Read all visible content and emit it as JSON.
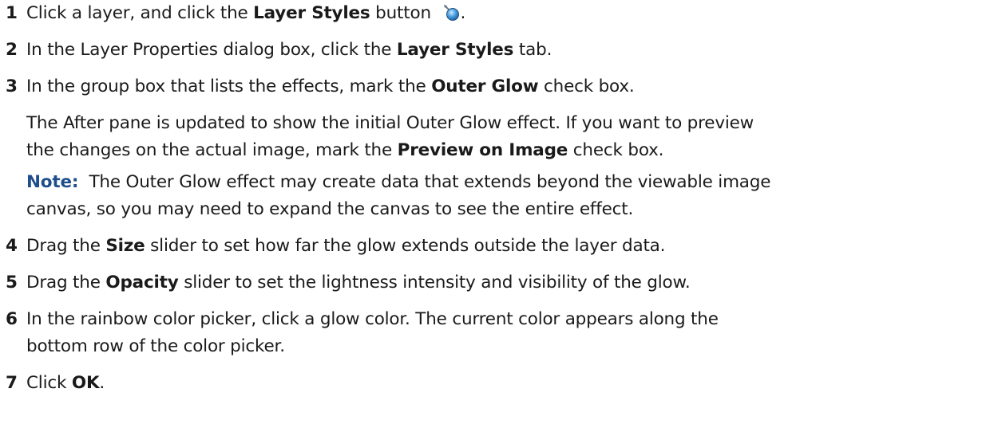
{
  "steps": [
    {
      "num": "1",
      "pre": "Click a layer, and click the ",
      "bold": "Layer Styles",
      "post": " button ",
      "after_icon": ".",
      "icon": "layer-styles-icon"
    },
    {
      "num": "2",
      "pre": "In the Layer Properties dialog box, click the ",
      "bold": "Layer Styles",
      "post": " tab."
    },
    {
      "num": "3",
      "pre": "In the group box that lists the effects, mark the ",
      "bold": "Outer Glow",
      "post": " check box."
    },
    {
      "num": "4",
      "pre": "Drag the ",
      "bold": "Size",
      "post": " slider to set how far the glow extends outside the layer data."
    },
    {
      "num": "5",
      "pre": "Drag the ",
      "bold": "Opacity",
      "post": " slider to set the lightness intensity and visibility of the glow."
    },
    {
      "num": "6",
      "line1": "In the rainbow color picker, click a glow color. The current color appears along the",
      "line2": "bottom row of the color picker."
    },
    {
      "num": "7",
      "pre": "Click ",
      "bold": "OK",
      "post": "."
    }
  ],
  "para": {
    "line1": "The After pane is updated to show the initial Outer Glow effect. If you want to preview",
    "line2_pre": "the changes on the actual image, mark the ",
    "line2_bold": "Preview on Image",
    "line2_post": " check box."
  },
  "note": {
    "label": "Note:",
    "line1": "  The Outer Glow effect may create data that extends beyond the viewable image",
    "line2": "canvas, so you may need to expand the canvas to see the entire effect."
  }
}
